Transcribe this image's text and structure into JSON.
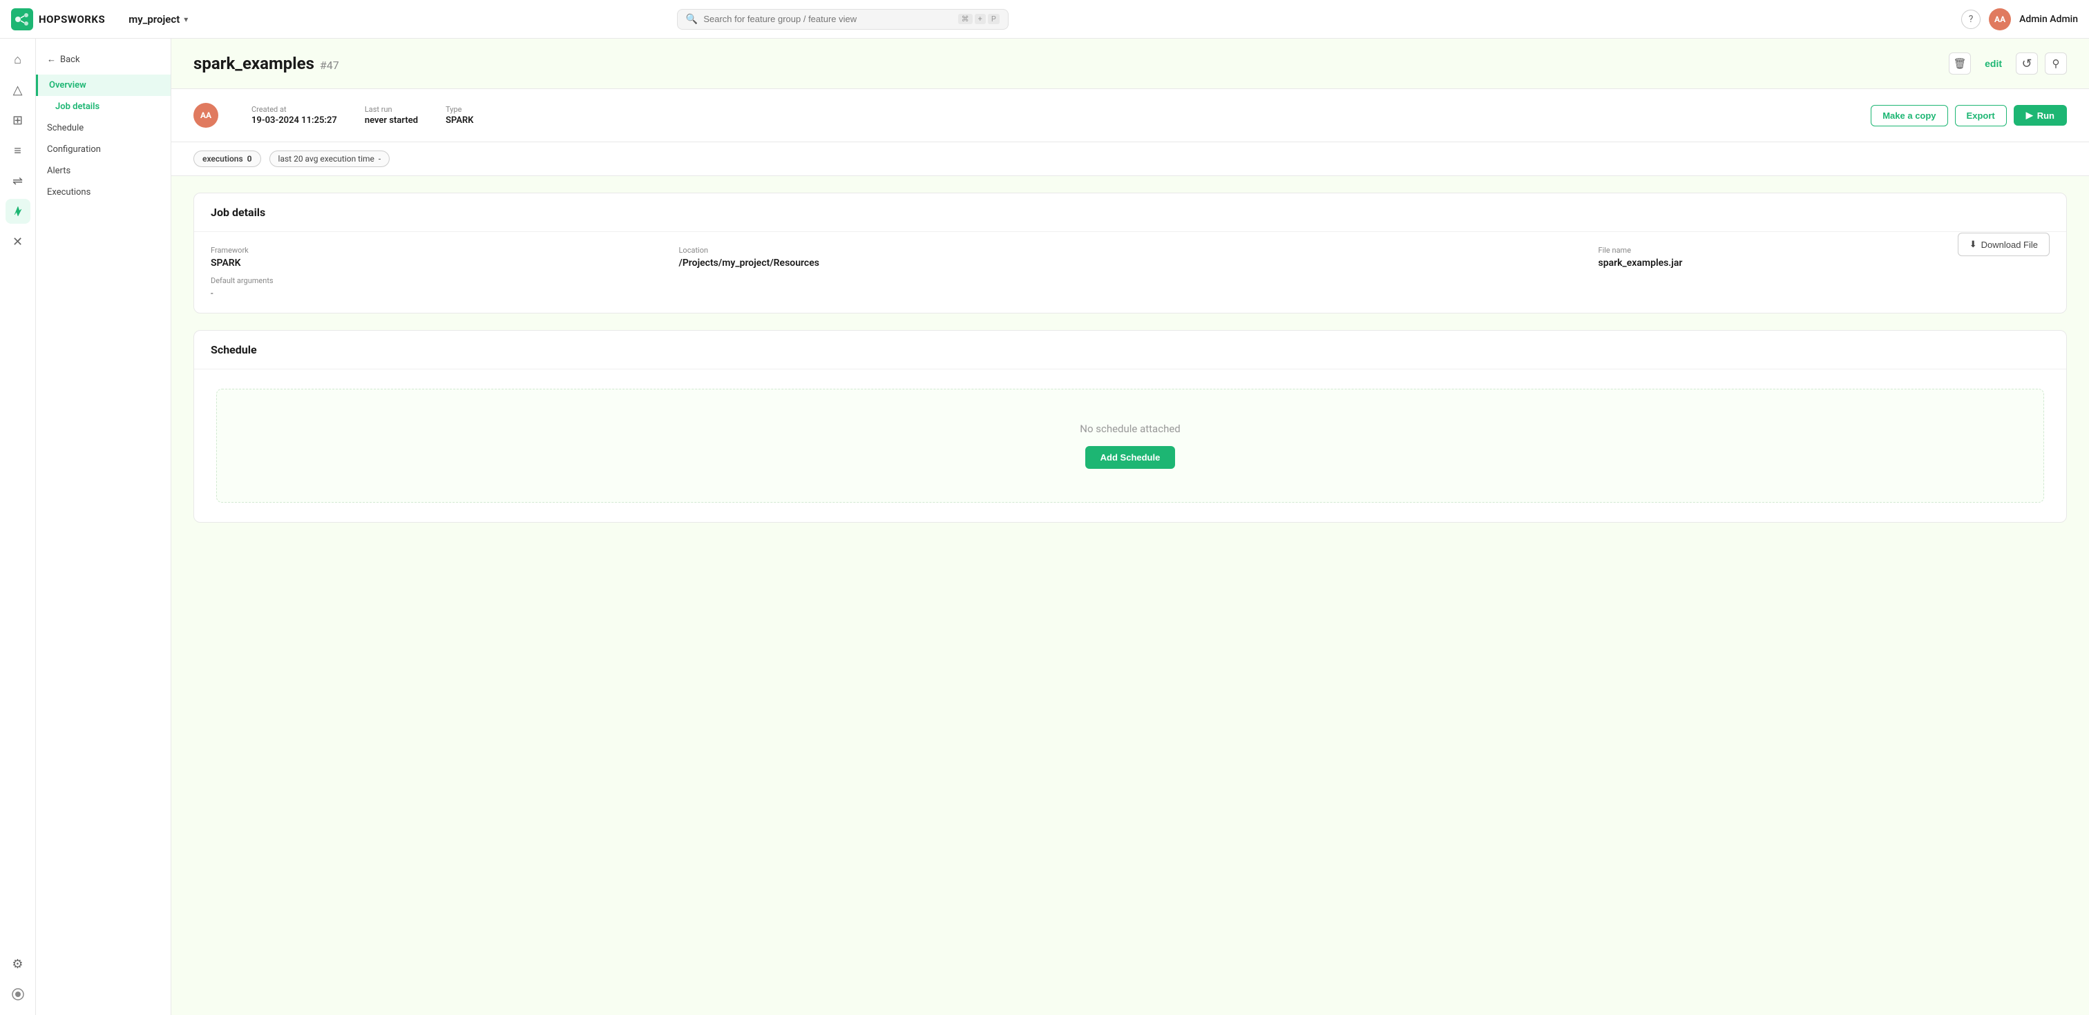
{
  "app": {
    "logo_text": "HOPSWORKS",
    "project_name": "my_project"
  },
  "topbar": {
    "search_placeholder": "Search for feature group / feature view",
    "kbd1": "⌘",
    "kbd2": "+",
    "kbd3": "P",
    "help_icon": "?",
    "avatar_initials": "AA",
    "user_name": "Admin Admin"
  },
  "icon_sidebar": {
    "items": [
      {
        "icon": "⌂",
        "name": "home",
        "active": false
      },
      {
        "icon": "△",
        "name": "delta",
        "active": false
      },
      {
        "icon": "⊞",
        "name": "grid",
        "active": false
      },
      {
        "icon": "≡",
        "name": "list",
        "active": false
      },
      {
        "icon": "⇌",
        "name": "arrows",
        "active": false
      },
      {
        "icon": "✦",
        "name": "spark",
        "active": true
      },
      {
        "icon": "✕",
        "name": "cross",
        "active": false
      },
      {
        "icon": "⚙",
        "name": "settings",
        "active": false
      }
    ]
  },
  "nav_sidebar": {
    "back_label": "Back",
    "items": [
      {
        "label": "Overview",
        "id": "overview",
        "active": true,
        "sub": false
      },
      {
        "label": "Job details",
        "id": "job-details",
        "active": false,
        "sub": true
      },
      {
        "label": "Schedule",
        "id": "schedule",
        "active": false,
        "sub": false
      },
      {
        "label": "Configuration",
        "id": "configuration",
        "active": false,
        "sub": false
      },
      {
        "label": "Alerts",
        "id": "alerts",
        "active": false,
        "sub": false
      },
      {
        "label": "Executions",
        "id": "executions",
        "active": false,
        "sub": false
      }
    ]
  },
  "page": {
    "title": "spark_examples",
    "id_label": "#47",
    "edit_label": "edit",
    "delete_icon": "🗑",
    "refresh_icon": "↺",
    "pin_icon": "⚲"
  },
  "meta": {
    "avatar_initials": "AA",
    "created_label": "Created at",
    "created_value": "19-03-2024 11:25:27",
    "last_run_label": "Last run",
    "last_run_value": "never started",
    "type_label": "Type",
    "type_value": "SPARK"
  },
  "header_actions": {
    "make_copy_label": "Make a copy",
    "export_label": "Export",
    "run_label": "Run"
  },
  "executions_bar": {
    "executions_label": "executions",
    "executions_count": "0",
    "time_label": "last 20 avg execution time",
    "time_dash": "-"
  },
  "job_details_section": {
    "title": "Job details",
    "framework_label": "Framework",
    "framework_value": "SPARK",
    "location_label": "Location",
    "location_value": "/Projects/my_project/Resources",
    "file_name_label": "File name",
    "file_name_value": "spark_examples.jar",
    "default_args_label": "Default arguments",
    "default_args_value": "-",
    "download_label": "Download File"
  },
  "schedule_section": {
    "title": "Schedule",
    "no_schedule_text": "No schedule attached",
    "add_schedule_label": "Add Schedule"
  }
}
